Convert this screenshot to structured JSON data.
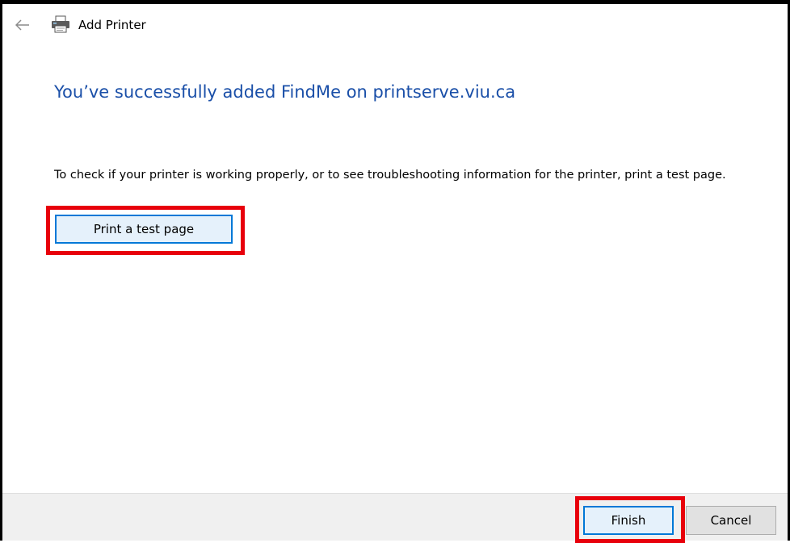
{
  "window": {
    "title": "Add Printer",
    "back_icon": "arrow-left-icon",
    "app_icon": "printer-icon"
  },
  "main": {
    "headline": "You’ve successfully added FindMe on printserve.viu.ca",
    "description": "To check if your printer is working properly, or to see troubleshooting information for the printer, print a test page.",
    "test_page_button": "Print a test page"
  },
  "footer": {
    "finish_label": "Finish",
    "cancel_label": "Cancel"
  },
  "colors": {
    "headline": "#1a4fa8",
    "highlight": "#e8000b",
    "default_button_border": "#0078d7",
    "footer_bg": "#f0f0f0"
  }
}
